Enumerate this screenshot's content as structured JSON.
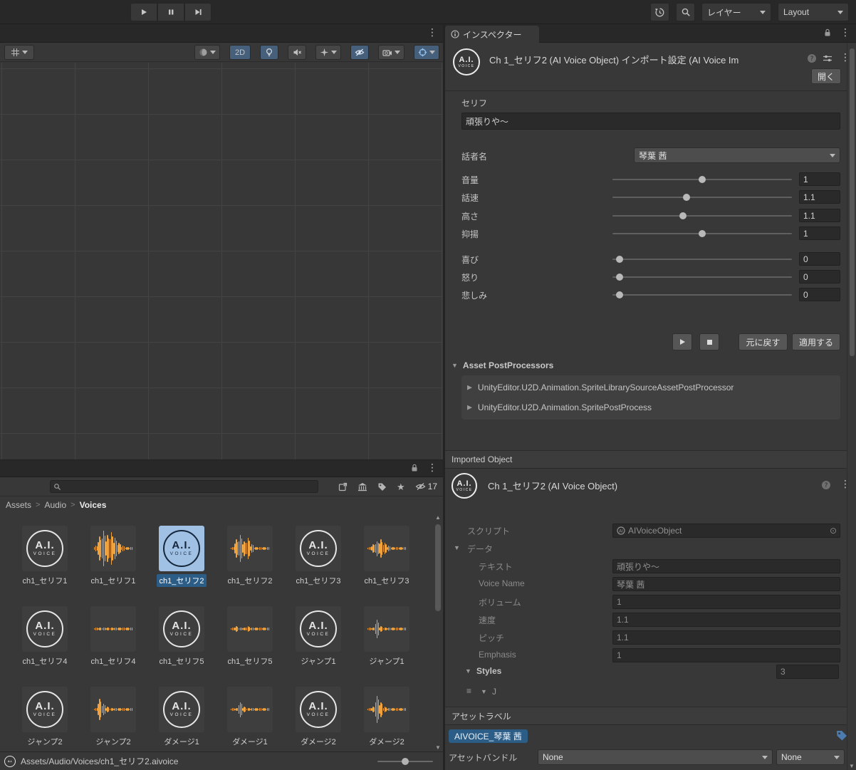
{
  "topbar": {
    "layers_label": "レイヤー",
    "layout_label": "Layout"
  },
  "icons": {
    "play": "triangle",
    "pause": "double-bar",
    "step": "triangle-bar",
    "history": "circular-arrow-clock",
    "search": "magnifier",
    "kebab": "⋮",
    "lock": "padlock",
    "info": "circle-i",
    "foldout_open": "▼",
    "foldout_closed": "▶",
    "star": "★",
    "object_picker": "⊙",
    "drag_handle": "≡",
    "tag": "label-tag"
  },
  "scene_toolbar": {
    "toggle_2d_label": "2D"
  },
  "project": {
    "breadcrumb": [
      "Assets",
      "Audio",
      "Voices"
    ],
    "hidden_count": "17",
    "assets": [
      {
        "label": "ch1_セリフ1",
        "kind": "logo"
      },
      {
        "label": "ch1_セリフ1",
        "kind": "wave",
        "wave": [
          2,
          8,
          12,
          9,
          11,
          7,
          4,
          2,
          1,
          1
        ]
      },
      {
        "label": "ch1_セリフ2",
        "kind": "logo",
        "selected": true
      },
      {
        "label": "ch1_セリフ2",
        "kind": "wave",
        "wave": [
          1,
          6,
          9,
          5,
          7,
          3,
          1,
          1,
          1,
          1
        ]
      },
      {
        "label": "ch1_セリフ3",
        "kind": "logo"
      },
      {
        "label": "ch1_セリフ3",
        "kind": "wave",
        "wave": [
          1,
          3,
          5,
          6,
          4,
          2,
          1,
          1,
          1,
          1
        ]
      },
      {
        "label": "ch1_セリフ4",
        "kind": "logo"
      },
      {
        "label": "ch1_セリフ4",
        "kind": "wave",
        "wave": [
          1,
          1,
          1,
          1,
          1,
          1,
          1,
          1,
          1,
          1
        ]
      },
      {
        "label": "ch1_セリフ5",
        "kind": "logo"
      },
      {
        "label": "ch1_セリフ5",
        "kind": "wave",
        "wave": [
          1,
          2,
          1,
          1,
          2,
          1,
          1,
          1,
          1,
          1
        ]
      },
      {
        "label": "ジャンプ1",
        "kind": "logo"
      },
      {
        "label": "ジャンプ1",
        "kind": "wave",
        "wave": [
          1,
          1,
          6,
          2,
          1,
          1,
          1,
          1,
          1,
          1
        ]
      },
      {
        "label": "ジャンプ2",
        "kind": "logo"
      },
      {
        "label": "ジャンプ2",
        "kind": "wave",
        "wave": [
          1,
          7,
          4,
          2,
          1,
          1,
          1,
          1,
          1,
          1
        ]
      },
      {
        "label": "ダメージ1",
        "kind": "logo"
      },
      {
        "label": "ダメージ1",
        "kind": "wave",
        "wave": [
          1,
          1,
          5,
          2,
          1,
          1,
          1,
          1,
          1,
          1
        ]
      },
      {
        "label": "ダメージ2",
        "kind": "logo"
      },
      {
        "label": "ダメージ2",
        "kind": "wave",
        "wave": [
          1,
          2,
          9,
          5,
          2,
          1,
          1,
          1,
          1,
          1
        ]
      }
    ]
  },
  "status_bar": {
    "path": "Assets/Audio/Voices/ch1_セリフ2.aivoice"
  },
  "inspector": {
    "tab_label": "インスペクター",
    "title": "Ch 1_セリフ2 (AI Voice Object) インポート設定 (AI Voice Im",
    "open_button": "開く",
    "serif": {
      "label": "セリフ",
      "value": "頑張りや～"
    },
    "speaker": {
      "label": "話者名",
      "value": "琴葉 茜"
    },
    "sliders": [
      {
        "label": "音量",
        "value": "1",
        "pos": 0.5
      },
      {
        "label": "話速",
        "value": "1.1",
        "pos": 0.41
      },
      {
        "label": "高さ",
        "value": "1.1",
        "pos": 0.39
      },
      {
        "label": "抑揚",
        "value": "1",
        "pos": 0.5
      },
      {
        "label": "喜び",
        "value": "0",
        "pos": 0.02
      },
      {
        "label": "怒り",
        "value": "0",
        "pos": 0.02
      },
      {
        "label": "悲しみ",
        "value": "0",
        "pos": 0.02
      }
    ],
    "revert_button": "元に戻す",
    "apply_button": "適用する",
    "postprocessors": {
      "header": "Asset PostProcessors",
      "items": [
        "UnityEditor.U2D.Animation.SpriteLibrarySourceAssetPostProcessor",
        "UnityEditor.U2D.Animation.SpritePostProcess"
      ]
    },
    "imported": {
      "bar_label": "Imported Object",
      "title": "Ch 1_セリフ2 (AI Voice Object)",
      "script_label": "スクリプト",
      "script_value": "AIVoiceObject",
      "data_label": "データ",
      "fields": [
        {
          "label": "テキスト",
          "value": "頑張りや～"
        },
        {
          "label": "Voice Name",
          "value": "琴葉 茜"
        },
        {
          "label": "ボリューム",
          "value": "1"
        },
        {
          "label": "速度",
          "value": "1.1"
        },
        {
          "label": "ピッチ",
          "value": "1.1"
        },
        {
          "label": "Emphasis",
          "value": "1"
        }
      ],
      "styles_label": "Styles",
      "styles_size": "3",
      "element_preview": "J"
    },
    "labels_section": {
      "header": "アセットラベル",
      "chip": "AIVOICE_琴葉 茜"
    },
    "bundle": {
      "label": "アセットバンドル",
      "bundle_value": "None",
      "variant_value": "None"
    }
  },
  "colors": {
    "selection": "#2c5d87",
    "waveform": "#f0a23c",
    "toggle_active": "#46607c"
  }
}
